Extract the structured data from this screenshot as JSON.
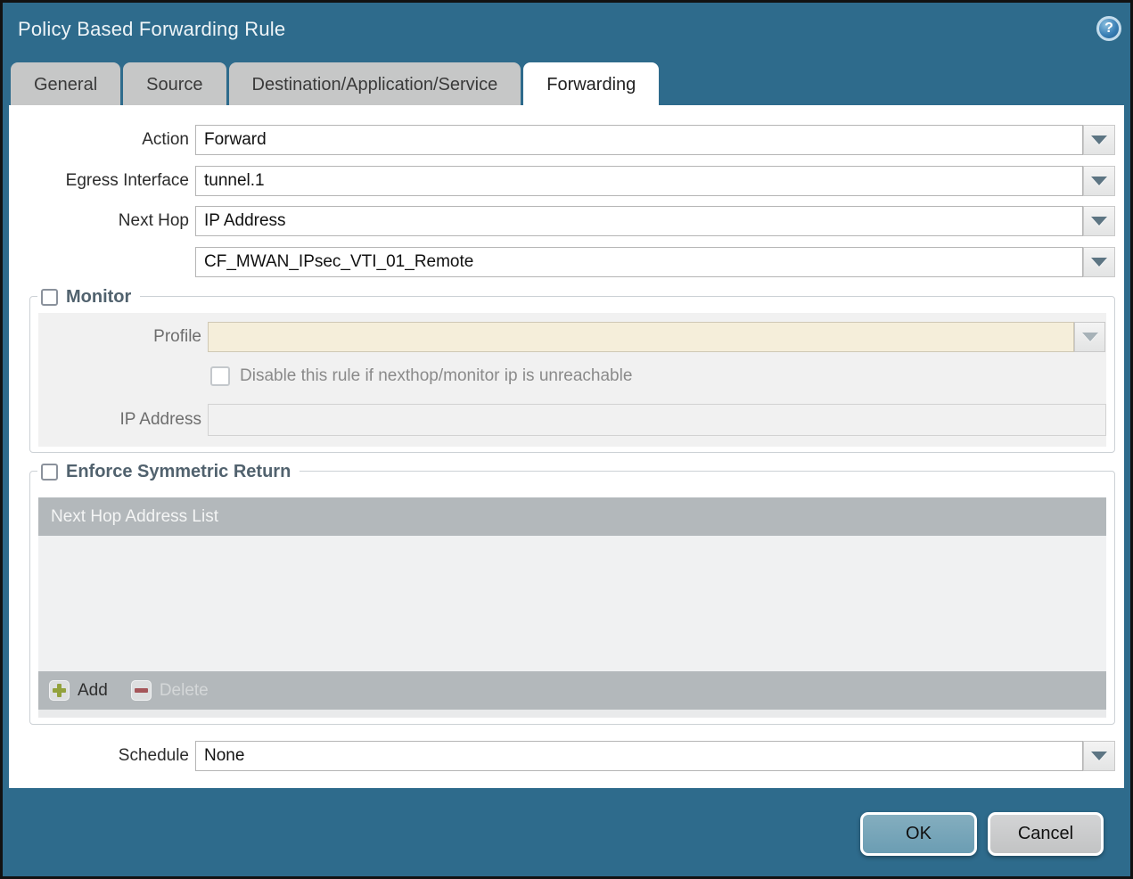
{
  "dialog": {
    "title": "Policy Based Forwarding Rule"
  },
  "icons": {
    "help": "?"
  },
  "tabs": [
    {
      "label": "General",
      "active": false
    },
    {
      "label": "Source",
      "active": false
    },
    {
      "label": "Destination/Application/Service",
      "active": false
    },
    {
      "label": "Forwarding",
      "active": true
    }
  ],
  "form": {
    "action": {
      "label": "Action",
      "value": "Forward"
    },
    "egress_interface": {
      "label": "Egress Interface",
      "value": "tunnel.1"
    },
    "next_hop": {
      "label": "Next Hop",
      "value": "IP Address"
    },
    "next_hop_address": {
      "value": "CF_MWAN_IPsec_VTI_01_Remote"
    },
    "schedule": {
      "label": "Schedule",
      "value": "None"
    }
  },
  "monitor": {
    "label": "Monitor",
    "checked": false,
    "profile": {
      "label": "Profile",
      "value": "",
      "disabled": true
    },
    "disable_rule": {
      "label": "Disable this rule if nexthop/monitor ip is unreachable",
      "checked": false,
      "disabled": true
    },
    "ip_address": {
      "label": "IP Address",
      "value": "",
      "disabled": true
    }
  },
  "enforce_symmetric_return": {
    "label": "Enforce Symmetric Return",
    "checked": false,
    "table": {
      "header": "Next Hop Address List",
      "rows": []
    },
    "add_label": "Add",
    "delete_label": "Delete",
    "delete_disabled": true
  },
  "footer": {
    "ok_label": "OK",
    "cancel_label": "Cancel"
  },
  "colors": {
    "chrome_teal": "#2e6b8c",
    "tab_inactive": "#c6c7c7",
    "field_disabled_beige": "#f5eeda",
    "panel_gray": "#f1f1f1",
    "table_bar_gray": "#b3b8bb",
    "legend_text": "#51626e",
    "ok_button": "#74a3b8",
    "cancel_button": "#c8c9ca",
    "add_plus_green": "#93a23d",
    "delete_minus_red": "#a5565a"
  }
}
